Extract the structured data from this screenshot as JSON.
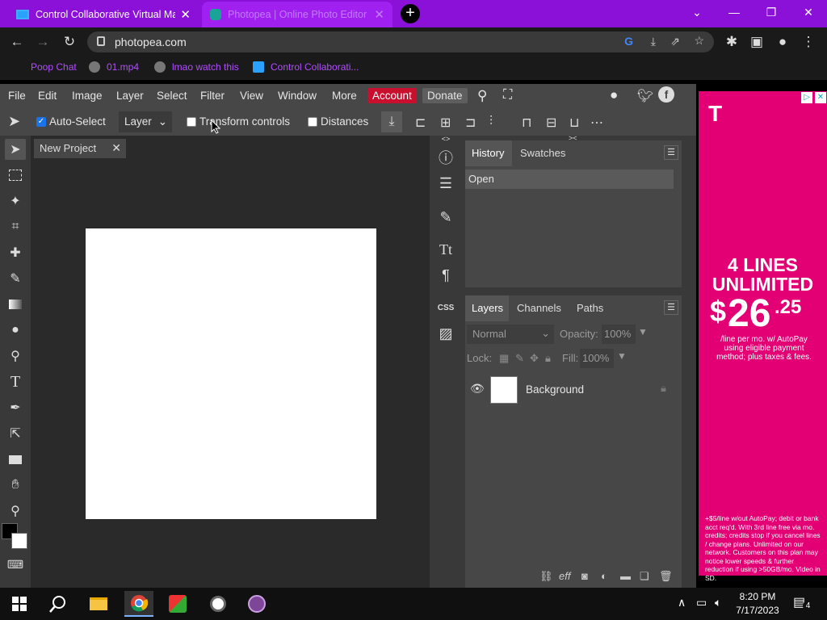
{
  "browser": {
    "tabs": [
      {
        "title": "Control Collaborative Virtual Mac",
        "active": true
      },
      {
        "title": "Photopea | Online Photo Editor",
        "active": false
      }
    ],
    "url": "photopea.com",
    "bookmarks": [
      "Poop Chat",
      "01.mp4",
      "lmao watch this",
      "Control Collaborati..."
    ]
  },
  "photopea": {
    "menu": [
      "File",
      "Edit",
      "Image",
      "Layer",
      "Select",
      "Filter",
      "View",
      "Window",
      "More"
    ],
    "account_label": "Account",
    "donate_label": "Donate",
    "options": {
      "auto_select_label": "Auto-Select",
      "auto_select_checked": true,
      "target_value": "Layer",
      "transform_controls_label": "Transform controls",
      "distances_label": "Distances"
    },
    "document_tab": "New Project",
    "history_panel": {
      "tabs": [
        "History",
        "Swatches"
      ],
      "items": [
        "Open"
      ]
    },
    "layers_panel": {
      "tabs": [
        "Layers",
        "Channels",
        "Paths"
      ],
      "blend_mode": "Normal",
      "opacity_label": "Opacity:",
      "opacity_value": "100%",
      "lock_label": "Lock:",
      "fill_label": "Fill:",
      "fill_value": "100%",
      "layers": [
        {
          "name": "Background",
          "locked": true,
          "visible": true
        }
      ],
      "footer_eff": "eff"
    },
    "panel_col_labels": {
      "css": "CSS"
    }
  },
  "ad": {
    "logo": "T",
    "headline_1": "4 LINES",
    "headline_2": "UNLIMITED",
    "price_symbol": "$",
    "price_main": "26",
    "price_cents": ".25",
    "price_sub": "/line per mo. w/ AutoPay using eligible payment method; plus taxes & fees.",
    "fine_print": "+$5/line w/out AutoPay; debit or bank acct req'd. With 3rd line free via mo. credits; credits stop if you cancel lines / change plans. Unlimited on our network. Customers on this plan may notice lower speeds & further reduction if using >50GB/mo. Video in SD."
  },
  "taskbar": {
    "time": "8:20 PM",
    "date": "7/17/2023",
    "notification_count": "4"
  },
  "colors": {
    "tab_strip": "#8b10d8",
    "account_red": "#c8102e",
    "ad_magenta": "#e20074"
  }
}
